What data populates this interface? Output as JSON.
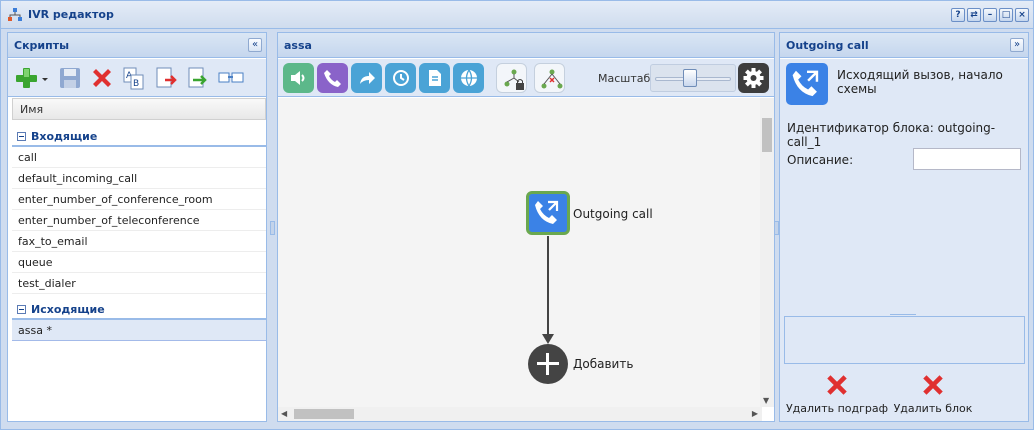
{
  "window": {
    "title": "IVR редактор",
    "controls": [
      "?",
      "⇄",
      "–",
      "□",
      "×"
    ]
  },
  "left_panel": {
    "title": "Скрипты",
    "collapse_glyph": "«",
    "column_header": "Имя",
    "groups": [
      {
        "title": "Входящие",
        "items": [
          "call",
          "default_incoming_call",
          "enter_number_of_conference_room",
          "enter_number_of_teleconference",
          "fax_to_email",
          "queue",
          "test_dialer"
        ]
      },
      {
        "title": "Исходящие",
        "items": [
          "assa *"
        ]
      }
    ],
    "toolbar_icons": [
      "add-icon",
      "dropdown-arrow-icon",
      "save-icon",
      "delete-icon",
      "rename-icon",
      "export-icon",
      "import-icon",
      "assign-icon"
    ]
  },
  "center_panel": {
    "title": "assa",
    "zoom_label": "Масштаб",
    "zoom_level": 0.45,
    "actions": [
      {
        "name": "play-sound",
        "color": "#5cb88a"
      },
      {
        "name": "call",
        "color": "#8a63c9"
      },
      {
        "name": "forward",
        "color": "#4aa3d6"
      },
      {
        "name": "timetable",
        "color": "#4aa3d6"
      },
      {
        "name": "document",
        "color": "#4aa3d6"
      },
      {
        "name": "web",
        "color": "#4aa3d6"
      }
    ],
    "flow": {
      "node_label": "Outgoing call",
      "add_label": "Добавить"
    }
  },
  "right_panel": {
    "title": "Outgoing call",
    "collapse_glyph": "»",
    "description": "Исходящий вызов, начало схемы",
    "block_id_text": "Идентификатор блока: outgoing-call_1",
    "description_label": "Описание:",
    "description_value": "",
    "delete_subgraph_label": "Удалить подграф",
    "delete_block_label": "Удалить блок"
  },
  "colors": {
    "header_text": "#15428b",
    "border": "#99bbe8",
    "panel_bg": "#dfe8f6",
    "node_blue": "#3b82e6",
    "node_border": "#6aa84f",
    "delete_red": "#e03030"
  }
}
